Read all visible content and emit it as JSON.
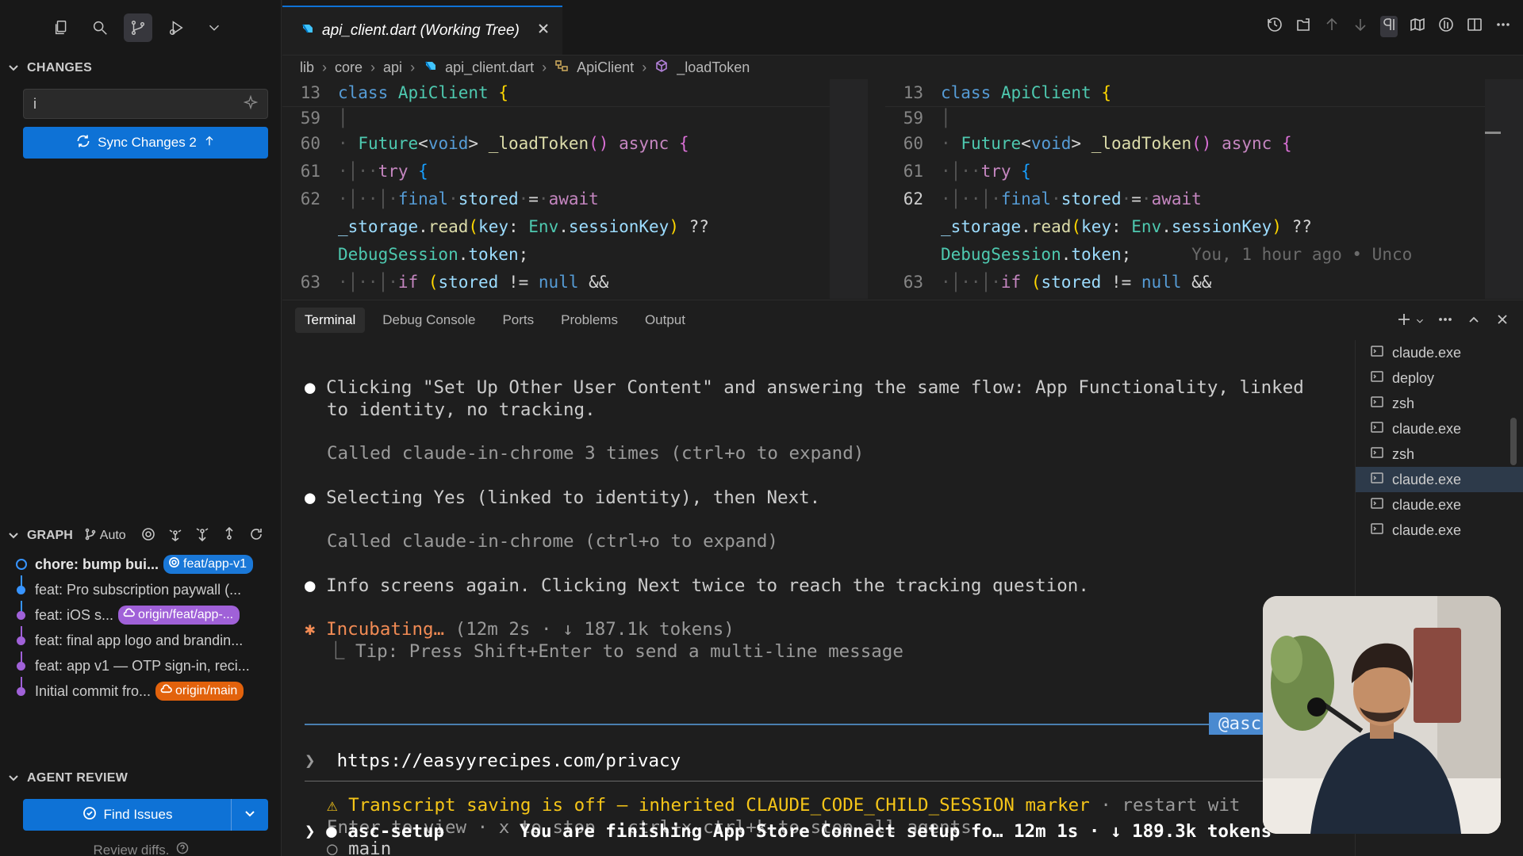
{
  "sidebar": {
    "changes_title": "CHANGES",
    "commit_message": "i",
    "sync_label": "Sync Changes 2",
    "graph_title": "GRAPH",
    "graph_auto": "Auto",
    "commits": [
      {
        "message": "chore: bump bui...",
        "badge": "feat/app-v1",
        "badge_color": "#1a78d8",
        "bold": true
      },
      {
        "message": "feat: Pro subscription paywall (...",
        "badge": "",
        "bold": false
      },
      {
        "message": "feat: iOS s...",
        "badge": "origin/feat/app-...",
        "badge_color": "#a061d8",
        "bold": false
      },
      {
        "message": "feat: final app logo and brandin...",
        "badge": "",
        "bold": false
      },
      {
        "message": "feat: app v1 — OTP sign-in, reci...",
        "badge": "",
        "bold": false
      },
      {
        "message": "Initial commit fro...",
        "badge": "origin/main",
        "badge_color": "#e2620c",
        "bold": false
      }
    ],
    "agent_review_title": "AGENT REVIEW",
    "find_issues_label": "Find Issues",
    "review_hint": "Review diffs."
  },
  "editor": {
    "tab_title": "api_client.dart (Working Tree)",
    "breadcrumb": [
      "lib",
      "core",
      "api",
      "api_client.dart",
      "ApiClient",
      "_loadToken"
    ],
    "lines": {
      "sticky_num": "13",
      "n59": "59",
      "n60": "60",
      "n61": "61",
      "n62": "62",
      "n63": "63"
    },
    "blame": "You, 1 hour ago • Unco"
  },
  "panel": {
    "tabs": [
      "Terminal",
      "Debug Console",
      "Ports",
      "Problems",
      "Output"
    ],
    "terminals": [
      "claude.exe",
      "deploy",
      "zsh",
      "claude.exe",
      "zsh",
      "claude.exe",
      "claude.exe",
      "claude.exe"
    ],
    "selected_terminal": 5
  },
  "terminal": {
    "l1a": "Clicking \"Set Up Other User Content\" and answering the same flow: App Functionality, linked",
    "l1b": "to identity, no tracking.",
    "l2": "Called claude-in-chrome 3 times (ctrl+o to expand)",
    "l3": "Selecting Yes (linked to identity), then Next.",
    "l4": "Called claude-in-chrome (ctrl+o to expand)",
    "l5": "Info screens again. Clicking Next twice to reach the tracking question.",
    "incubating": "Incubating…",
    "incubating_stats": "(12m 2s · ↓ 187.1k tokens)",
    "tip": "⎿ Tip: Press Shift+Enter to send a multi-line message",
    "session_tag": "@asc-s",
    "prompt_input": "https://easyyrecipes.com/privacy",
    "warn_a": "Transcript saving is off — inherited CLAUDE_CODE_CHILD_SESSION marker",
    "warn_a_tail": " · restart wit",
    "warn_b": "Enter to view · x to stop · ctrl+x ctrl+k to stop all agents",
    "agent_main": "main",
    "agent_setup": "asc-setup",
    "agent_setup_desc": "You are finishing App Store Connect setup fo… 12m 1s · ↓ 189.3k tokens"
  }
}
